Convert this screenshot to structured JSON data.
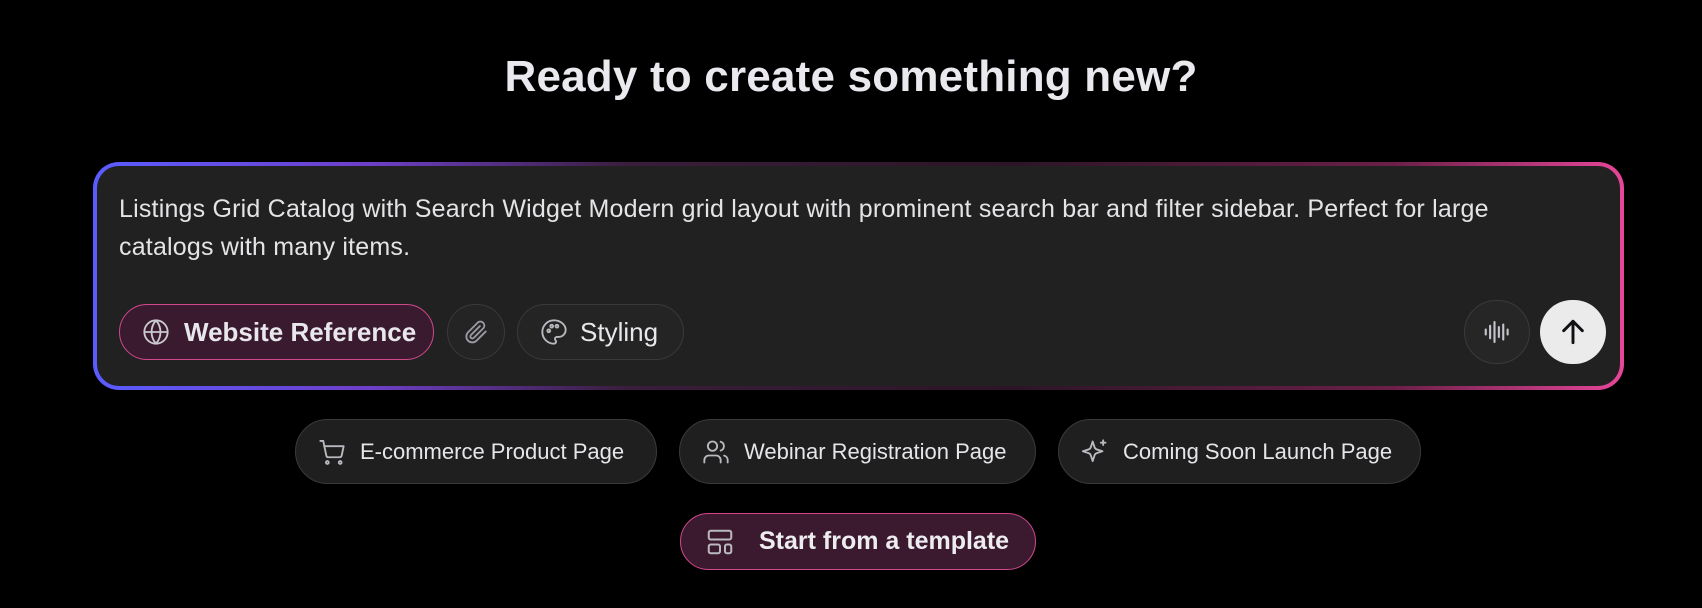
{
  "heading": "Ready to create something new?",
  "prompt": {
    "text": "Listings Grid Catalog with Search Widget Modern grid layout with prominent search bar and filter sidebar. Perfect for large catalogs with many items."
  },
  "toolbar": {
    "website_reference_label": "Website Reference",
    "styling_label": "Styling"
  },
  "icons": {
    "website_reference": "globe-icon",
    "attach": "paperclip-icon",
    "styling": "palette-icon",
    "voice": "audio-waveform-icon",
    "send": "arrow-up-icon",
    "suggestion_1": "shopping-cart-icon",
    "suggestion_2": "users-icon",
    "suggestion_3": "sparkles-icon",
    "template": "layout-template-icon"
  },
  "suggestions": [
    {
      "label": "E-commerce Product Page"
    },
    {
      "label": "Webinar Registration Page"
    },
    {
      "label": "Coming Soon Launch Page"
    }
  ],
  "template_button": {
    "label": "Start from a template"
  },
  "colors": {
    "background": "#000000",
    "accent_pink": "#d0488c",
    "accent_blue": "#5b5cff",
    "input_bg": "#212121"
  }
}
